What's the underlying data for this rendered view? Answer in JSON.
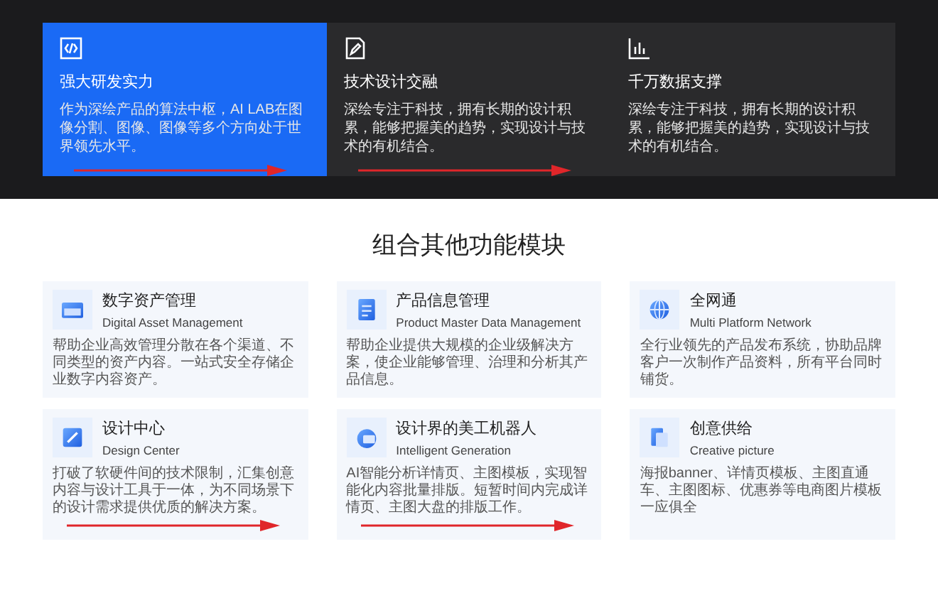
{
  "features": [
    {
      "kind": "code",
      "title": "强大研发实力",
      "description": "作为深绘产品的算法中枢，AI LAB在图像分割、图像、图像等多个方向处于世界领先水平。",
      "selected": true,
      "marked": true
    },
    {
      "kind": "edit",
      "title": "技术设计交融",
      "description": "深绘专注于科技，拥有长期的设计积累，能够把握美的趋势，实现设计与技术的有机结合。",
      "selected": false,
      "marked": true
    },
    {
      "kind": "chart",
      "title": "千万数据支撑",
      "description": "深绘专注于科技，拥有长期的设计积累，能够把握美的趋势，实现设计与技术的有机结合。",
      "selected": false,
      "marked": false
    }
  ],
  "section_title": "组合其他功能模块",
  "modules": [
    {
      "kind": "folder",
      "title": "数字资产管理",
      "subtitle": "Digital Asset Management",
      "description": "帮助企业高效管理分散在各个渠道、不同类型的资产内容。一站式安全存储企业数字内容资产。",
      "marked": false
    },
    {
      "kind": "list",
      "title": "产品信息管理",
      "subtitle": "Product Master Data Management",
      "description": "帮助企业提供大规模的企业级解决方案，使企业能够管理、治理和分析其产品信息。",
      "marked": false
    },
    {
      "kind": "globe",
      "title": "全网通",
      "subtitle": "Multi Platform Network",
      "description": "全行业领先的产品发布系统，协助品牌客户一次制作产品资料，所有平台同时铺货。",
      "marked": false
    },
    {
      "kind": "pen",
      "title": "设计中心",
      "subtitle": "Design Center",
      "description": "打破了软硬件间的技术限制，汇集创意内容与设计工具于一体，为不同场景下的设计需求提供优质的解决方案。",
      "marked": true
    },
    {
      "kind": "ai",
      "title": "设计界的美工机器人",
      "subtitle": "Intelligent Generation",
      "description": "AI智能分析详情页、主图模板，实现智能化内容批量排版。短暂时间内完成详情页、主图大盘的排版工作。",
      "marked": true
    },
    {
      "kind": "doc",
      "title": "创意供给",
      "subtitle": "Creative picture",
      "description": "海报banner、详情页模板、主图直通车、主图图标、优惠券等电商图片模板一应俱全",
      "marked": false
    }
  ]
}
